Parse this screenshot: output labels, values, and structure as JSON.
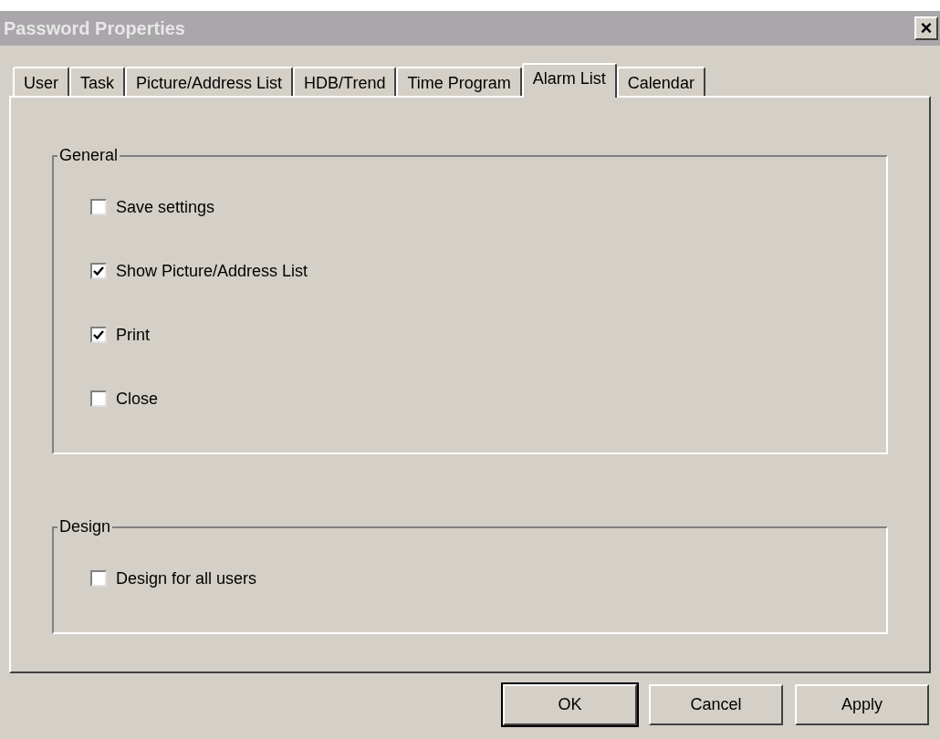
{
  "window": {
    "title": "Password Properties",
    "close": "×"
  },
  "tabs": [
    {
      "label": "User",
      "selected": false
    },
    {
      "label": "Task",
      "selected": false
    },
    {
      "label": "Picture/Address List",
      "selected": false
    },
    {
      "label": "HDB/Trend",
      "selected": false
    },
    {
      "label": "Time Program",
      "selected": false
    },
    {
      "label": "Alarm List",
      "selected": true
    },
    {
      "label": "Calendar",
      "selected": false
    }
  ],
  "groups": [
    {
      "title": "General",
      "options": [
        {
          "label": "Save settings",
          "checked": false
        },
        {
          "label": "Show Picture/Address List",
          "checked": true
        },
        {
          "label": "Print",
          "checked": true
        },
        {
          "label": "Close",
          "checked": false
        }
      ]
    },
    {
      "title": "Design",
      "options": [
        {
          "label": "Design for all users",
          "checked": false
        }
      ]
    }
  ],
  "buttons": [
    {
      "label": "OK",
      "default": true
    },
    {
      "label": "Cancel",
      "default": false
    },
    {
      "label": "Apply",
      "default": false
    }
  ]
}
